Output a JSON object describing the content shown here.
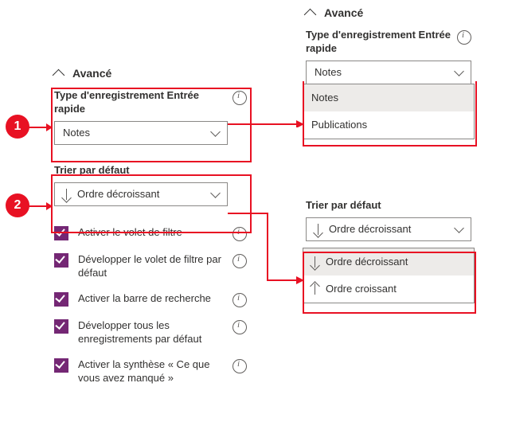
{
  "header": {
    "title": "Avancé"
  },
  "recordType": {
    "label": "Type d'enregistrement Entrée rapide",
    "value": "Notes",
    "options": [
      "Notes",
      "Publications"
    ]
  },
  "sortDefault": {
    "label": "Trier par défaut",
    "value": "Ordre décroissant",
    "options": [
      "Ordre décroissant",
      "Ordre croissant"
    ]
  },
  "checkboxes": {
    "filterPane": "Activer le volet de filtre",
    "expandFilter": "Développer le volet de filtre par défaut",
    "searchBar": "Activer la barre de recherche",
    "expandAll": "Développer tous les enregistrements par défaut",
    "summary": "Activer la synthèse « Ce que vous avez manqué »"
  },
  "markers": {
    "one": "1",
    "two": "2"
  }
}
